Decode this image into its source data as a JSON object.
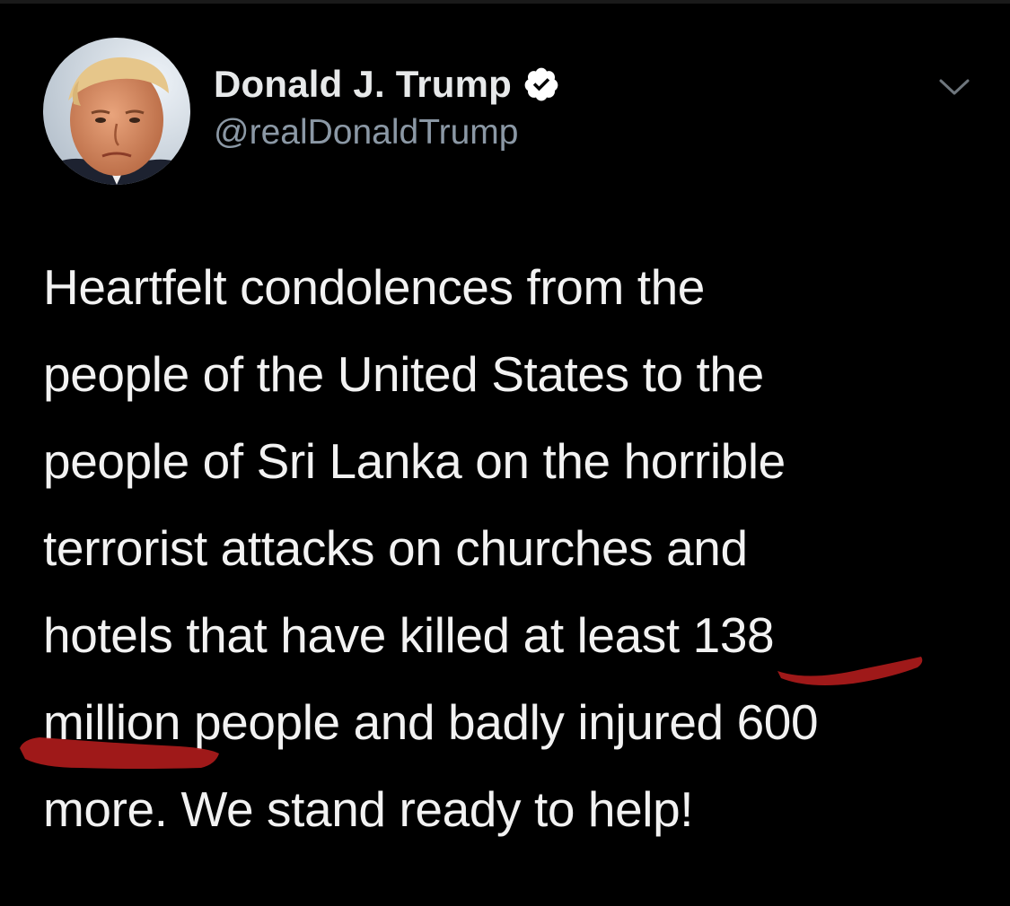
{
  "tweet": {
    "display_name": "Donald J. Trump",
    "handle": "@realDonaldTrump",
    "verified": true,
    "text_lines": [
      "Heartfelt condolences from the",
      "people of the United States to the",
      "people of Sri Lanka on the horrible",
      "terrorist attacks on churches and",
      "hotels that have killed at least 138",
      "million people and badly injured 600",
      "more. We stand ready to help!"
    ]
  },
  "icons": {
    "verified": "verified-badge-icon",
    "menu": "chevron-down-icon",
    "avatar": "profile-photo"
  },
  "colors": {
    "background": "#000000",
    "text": "#f2f2f2",
    "secondary_text": "#8b98a5",
    "annotation_marker": "#b01c1c"
  }
}
